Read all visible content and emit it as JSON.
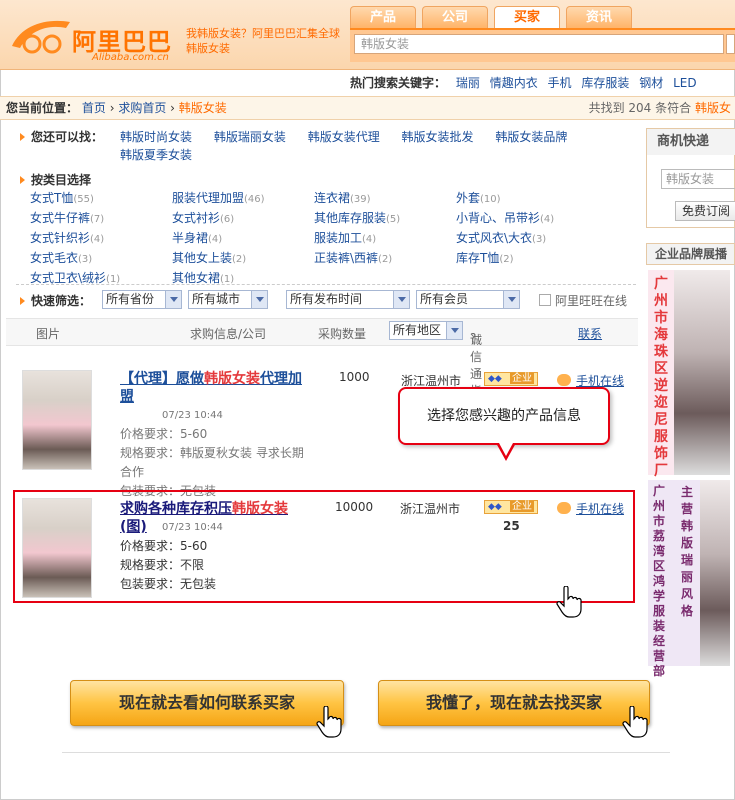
{
  "header": {
    "logo_cn": "阿里巴巴",
    "logo_en": "Alibaba.com.cn",
    "promo": "我韩版女装？阿里巴巴汇集全球韩版女装",
    "tabs": [
      "产品",
      "公司",
      "买家",
      "资讯"
    ],
    "active_tab": "买家",
    "search_value": "韩版女装",
    "hot_label": "热门搜索关键字：",
    "hot_keywords": [
      "瑞丽",
      "情趣内衣",
      "手机",
      "库存服装",
      "钢材",
      "LED"
    ]
  },
  "breadcrumb": {
    "label": "您当前位置：",
    "items": [
      "首页",
      "求购首页",
      "韩版女装"
    ],
    "found_prefix": "共找到",
    "found_count": "204",
    "found_suffix": "条符合",
    "found_keyword": "韩版女"
  },
  "also_find": {
    "label": "您还可以找：",
    "links": [
      "韩版时尚女装",
      "韩版瑞丽女装",
      "韩版女装代理",
      "韩版女装批发",
      "韩版女装品牌",
      "韩版夏季女装"
    ]
  },
  "categories": {
    "label": "按类目选择",
    "items": [
      {
        "name": "女式T恤",
        "count": "(55)"
      },
      {
        "name": "服装代理加盟",
        "count": "(46)"
      },
      {
        "name": "连衣裙",
        "count": "(39)"
      },
      {
        "name": "外套",
        "count": "(10)"
      },
      {
        "name": "女式牛仔裤",
        "count": "(7)"
      },
      {
        "name": "女式衬衫",
        "count": "(6)"
      },
      {
        "name": "其他库存服装",
        "count": "(5)"
      },
      {
        "name": "小背心、吊带衫",
        "count": "(4)"
      },
      {
        "name": "女式针织衫",
        "count": "(4)"
      },
      {
        "name": "半身裙",
        "count": "(4)"
      },
      {
        "name": "服装加工",
        "count": "(4)"
      },
      {
        "name": "女式风衣\\大衣",
        "count": "(3)"
      },
      {
        "name": "女式毛衣",
        "count": "(3)"
      },
      {
        "name": "其他女上装",
        "count": "(2)"
      },
      {
        "name": "正装裤\\西裤",
        "count": "(2)"
      },
      {
        "name": "库存T恤",
        "count": "(2)"
      },
      {
        "name": "女式卫衣\\绒衫",
        "count": "(1)"
      },
      {
        "name": "其他女裙",
        "count": "(1)"
      }
    ]
  },
  "quick_filter": {
    "label": "快速筛选：",
    "selects": [
      "所有省份",
      "所有城市",
      "所有发布时间",
      "所有会员"
    ],
    "checkbox_label": "阿里旺旺在线"
  },
  "table_header": {
    "pic": "图片",
    "info": "求购信息/公司",
    "qty": "采购数量",
    "region": "所有地区",
    "credit": "诚信通指数",
    "contact": "联系"
  },
  "listings": [
    {
      "title_pre": "【代理】愿做",
      "title_hl": "韩版女装",
      "title_post": "代理加盟",
      "date": "07/23 10:44",
      "price_label": "价格要求：",
      "price": "5-60",
      "spec_label": "规格要求：",
      "spec": "韩版夏秋女装 寻求长期合作",
      "pack_label": "包装要求：",
      "pack": "无包装",
      "qty": "1000",
      "location": "浙江温州市",
      "badge": "企业",
      "contact": "手机在线"
    },
    {
      "title_pre": "求购各种库存积压",
      "title_hl": "韩版女装",
      "title_post": "(图)",
      "date": "07/23 10:44",
      "price_label": "价格要求：",
      "price": "5-60",
      "spec_label": "规格要求：",
      "spec": "不限",
      "pack_label": "包装要求：",
      "pack": "无包装",
      "qty": "10000",
      "location": "浙江温州市",
      "badge": "企业",
      "credit": "25",
      "contact": "手机在线"
    }
  ],
  "tooltip": "选择您感兴趣的产品信息",
  "sidebar": {
    "express_title": "商机快递",
    "express_input": "韩版女装",
    "express_button": "免费订阅",
    "brand_title": "企业品牌展播",
    "ad1": "广州市海珠区逆迩尼服饰厂",
    "ad2_left": "广州市荔湾区鸿学服装经营部",
    "ad2_right": "主营韩版瑞丽风格"
  },
  "bottom": {
    "btn_left": "现在就去看如何联系买家",
    "btn_right": "我懂了，现在就去找买家"
  },
  "colors": {
    "accent": "#ff6a00",
    "highlight_border": "#e60012",
    "link": "#1d4f9a"
  }
}
